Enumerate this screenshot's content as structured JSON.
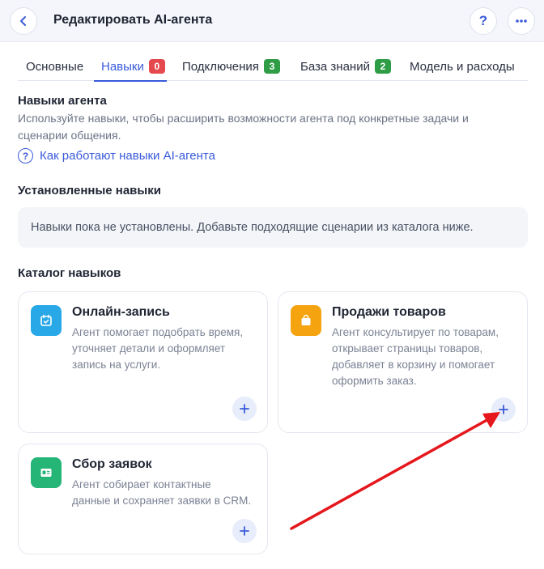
{
  "header": {
    "title": "Редактировать AI-агента",
    "help_label": "?"
  },
  "tabs": [
    {
      "label": "Основные"
    },
    {
      "label": "Навыки",
      "badge": "0"
    },
    {
      "label": "Подключения",
      "badge": "3"
    },
    {
      "label": "База знаний",
      "badge": "2"
    },
    {
      "label": "Модель и расходы"
    }
  ],
  "skills_section": {
    "title": "Навыки агента",
    "description": "Используйте навыки, чтобы расширить возможности агента под конкретные задачи и сценарии общения.",
    "help_link": "Как работают навыки AI-агента",
    "help_icon": "?"
  },
  "installed": {
    "title": "Установленные навыки",
    "empty_text": "Навыки пока не установлены. Добавьте подходящие сценарии из каталога ниже."
  },
  "catalog": {
    "title": "Каталог навыков",
    "cards": [
      {
        "title": "Онлайн-запись",
        "description": [
          "Агент помогает подобрать время,",
          "уточняет детали и оформляет",
          "запись на услуги."
        ],
        "icon": "calendar-icon",
        "color": "#29a8e8"
      },
      {
        "title": "Продажи товаров",
        "description": [
          "Агент консультирует по товарам,",
          "открывает страницы товаров,",
          "добавляет в корзину и помогает",
          "оформить заказ."
        ],
        "icon": "shopping-bag-icon",
        "color": "#f5a30f"
      },
      {
        "title": "Сбор заявок",
        "description": [
          "Агент собирает контактные",
          "данные и сохраняет заявки в CRM."
        ],
        "icon": "id-card-icon",
        "color": "#25b577"
      }
    ]
  },
  "colors": {
    "accent": "#3a5bd9",
    "annotation_arrow": "#e5171c"
  }
}
